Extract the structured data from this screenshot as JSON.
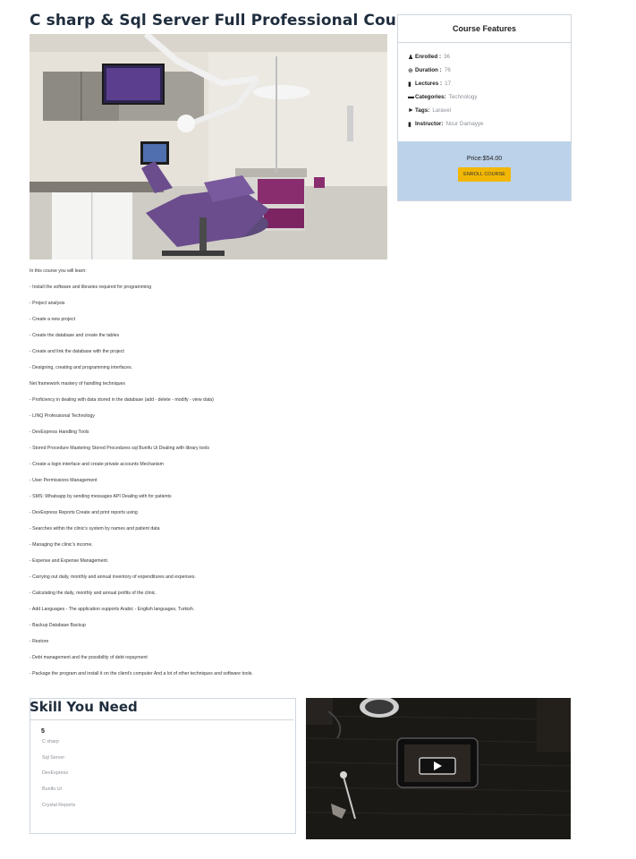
{
  "course": {
    "title": "C sharp & Sql Server Full Professional Course"
  },
  "features": {
    "heading": "Course Features",
    "rows": [
      {
        "icon": "user-icon",
        "label": "Enrolled :",
        "value": "36"
      },
      {
        "icon": "clock-icon",
        "label": "Duration :",
        "value": "76"
      },
      {
        "icon": "book-icon",
        "label": "Lectures :",
        "value": "17"
      },
      {
        "icon": "folder-icon",
        "label": "Categories:",
        "value": "Technology"
      },
      {
        "icon": "tag-icon",
        "label": "Tags:",
        "value": "Laravel"
      },
      {
        "icon": "instructor-icon",
        "label": "Instructor:",
        "value": "Nour Damayye"
      }
    ],
    "price": "Price:$54.00",
    "enroll_label": "ENROLL COURSE"
  },
  "description": {
    "lines": [
      "In this course you will learn:",
      "- Install the software and libraries required for programming",
      "- Project analysis",
      "- Create a new project",
      "- Create the database and create the tables",
      "- Create and link the database with the project",
      "- Designing, creating and programming interfaces.",
      "Net framework mastery of handling techniques",
      "- Proficiency in dealing with data stored in the database (add - delete - modify - view data)",
      "- LINQ Professional Technology",
      "- DevExpress Handling Tools",
      "- Stored Procedure Mastering Stored Procedures sql  Bunifu Ui Dealing with library tools",
      "- Create a login interface and create private accounts Mechanism",
      "- User Permissions Management",
      "- SMS: Whatsapp by sending messages API Dealing with for patients",
      "- DevExpress Reports Create and print reports using",
      "- Searches within the clinic's system by names and patient data",
      "- Managing the clinic's income.",
      "- Expense and Expense Management.",
      "- Carrying out daily, monthly and annual inventory of expenditures and expenses.",
      "- Calculating the daily, monthly and annual profits of the clinic.",
      "- Add Languages  - The application supports Arabic - English languages, Turkish.",
      "- Backup Database Backup",
      "- Restore",
      "- Debt management and the possibility of debt repayment",
      "- Package the program and install it on the client's computer And a lot of other techniques and software tools."
    ]
  },
  "skills": {
    "heading": "Skill You Need",
    "number": "5",
    "items": [
      "C sharp",
      "Sql Server",
      "DevExpress",
      "Bunifu Ui",
      "Crystal Reports"
    ]
  },
  "colors": {
    "price_bg": "#bcd2ea",
    "enroll_btn": "#f2b705",
    "title": "#1f2d3d",
    "muted": "#8a8f96"
  }
}
